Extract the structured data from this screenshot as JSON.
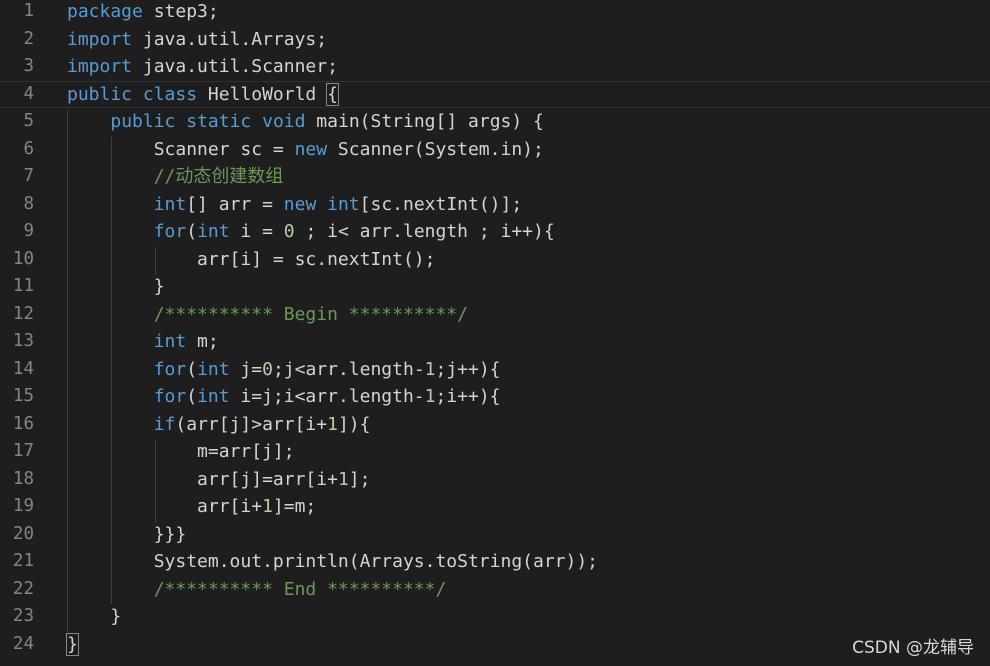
{
  "colors": {
    "background": "#1e1e1e",
    "line_number": "#858585",
    "default_text": "#d4d4d4",
    "keyword": "#569cd6",
    "number": "#b5cea8",
    "comment": "#6a9955"
  },
  "editor": {
    "current_line": 4,
    "lines": [
      {
        "number": "1",
        "tokens": [
          {
            "t": "package",
            "k": "keyword"
          },
          {
            "t": " step3;",
            "k": "text"
          }
        ]
      },
      {
        "number": "2",
        "tokens": [
          {
            "t": "import",
            "k": "keyword"
          },
          {
            "t": " java.util.Arrays;",
            "k": "text"
          }
        ]
      },
      {
        "number": "3",
        "tokens": [
          {
            "t": "import",
            "k": "keyword"
          },
          {
            "t": " java.util.Scanner;",
            "k": "text"
          }
        ]
      },
      {
        "number": "4",
        "tokens": [
          {
            "t": "public",
            "k": "keyword"
          },
          {
            "t": " ",
            "k": "text"
          },
          {
            "t": "class",
            "k": "keyword"
          },
          {
            "t": " HelloWorld ",
            "k": "text"
          },
          {
            "t": "{",
            "k": "brace-highlight"
          }
        ]
      },
      {
        "number": "5",
        "tokens": [
          {
            "t": "    ",
            "k": "text"
          },
          {
            "t": "public",
            "k": "keyword"
          },
          {
            "t": " ",
            "k": "text"
          },
          {
            "t": "static",
            "k": "keyword"
          },
          {
            "t": " ",
            "k": "text"
          },
          {
            "t": "void",
            "k": "keyword"
          },
          {
            "t": " main(String[] args) {",
            "k": "text"
          }
        ]
      },
      {
        "number": "6",
        "tokens": [
          {
            "t": "        Scanner sc = ",
            "k": "text"
          },
          {
            "t": "new",
            "k": "keyword"
          },
          {
            "t": " Scanner(System.in);",
            "k": "text"
          }
        ]
      },
      {
        "number": "7",
        "tokens": [
          {
            "t": "        ",
            "k": "text"
          },
          {
            "t": "//动态创建数组",
            "k": "comment"
          }
        ]
      },
      {
        "number": "8",
        "tokens": [
          {
            "t": "        ",
            "k": "text"
          },
          {
            "t": "int",
            "k": "keyword"
          },
          {
            "t": "[] arr = ",
            "k": "text"
          },
          {
            "t": "new",
            "k": "keyword"
          },
          {
            "t": " ",
            "k": "text"
          },
          {
            "t": "int",
            "k": "keyword"
          },
          {
            "t": "[sc.nextInt()];",
            "k": "text"
          }
        ]
      },
      {
        "number": "9",
        "tokens": [
          {
            "t": "        ",
            "k": "text"
          },
          {
            "t": "for",
            "k": "control"
          },
          {
            "t": "(",
            "k": "text"
          },
          {
            "t": "int",
            "k": "keyword"
          },
          {
            "t": " i = ",
            "k": "text"
          },
          {
            "t": "0",
            "k": "number"
          },
          {
            "t": " ; i< arr.length ; i++){",
            "k": "text"
          }
        ]
      },
      {
        "number": "10",
        "tokens": [
          {
            "t": "            arr[i] = sc.nextInt();",
            "k": "text"
          }
        ]
      },
      {
        "number": "11",
        "tokens": [
          {
            "t": "        }",
            "k": "text"
          }
        ]
      },
      {
        "number": "12",
        "tokens": [
          {
            "t": "        ",
            "k": "text"
          },
          {
            "t": "/********** Begin **********/",
            "k": "comment"
          }
        ]
      },
      {
        "number": "13",
        "tokens": [
          {
            "t": "        ",
            "k": "text"
          },
          {
            "t": "int",
            "k": "keyword"
          },
          {
            "t": " m;",
            "k": "text"
          }
        ]
      },
      {
        "number": "14",
        "tokens": [
          {
            "t": "        ",
            "k": "text"
          },
          {
            "t": "for",
            "k": "control"
          },
          {
            "t": "(",
            "k": "text"
          },
          {
            "t": "int",
            "k": "keyword"
          },
          {
            "t": " j=",
            "k": "text"
          },
          {
            "t": "0",
            "k": "number"
          },
          {
            "t": ";j<arr.length-",
            "k": "text"
          },
          {
            "t": "1",
            "k": "number"
          },
          {
            "t": ";j++){",
            "k": "text"
          }
        ]
      },
      {
        "number": "15",
        "tokens": [
          {
            "t": "        ",
            "k": "text"
          },
          {
            "t": "for",
            "k": "control"
          },
          {
            "t": "(",
            "k": "text"
          },
          {
            "t": "int",
            "k": "keyword"
          },
          {
            "t": " i=j;i<arr.length-",
            "k": "text"
          },
          {
            "t": "1",
            "k": "number"
          },
          {
            "t": ";i++){",
            "k": "text"
          }
        ]
      },
      {
        "number": "16",
        "tokens": [
          {
            "t": "        ",
            "k": "text"
          },
          {
            "t": "if",
            "k": "control"
          },
          {
            "t": "(arr[j]>arr[i+",
            "k": "text"
          },
          {
            "t": "1",
            "k": "number"
          },
          {
            "t": "]){",
            "k": "text"
          }
        ]
      },
      {
        "number": "17",
        "tokens": [
          {
            "t": "            m=arr[j];",
            "k": "text"
          }
        ]
      },
      {
        "number": "18",
        "tokens": [
          {
            "t": "            arr[j]=arr[i+",
            "k": "text"
          },
          {
            "t": "1",
            "k": "number"
          },
          {
            "t": "];",
            "k": "text"
          }
        ]
      },
      {
        "number": "19",
        "tokens": [
          {
            "t": "            arr[i+",
            "k": "text"
          },
          {
            "t": "1",
            "k": "number"
          },
          {
            "t": "]=m;",
            "k": "text"
          }
        ]
      },
      {
        "number": "20",
        "tokens": [
          {
            "t": "        }}}",
            "k": "text"
          }
        ]
      },
      {
        "number": "21",
        "tokens": [
          {
            "t": "        System.out.println(Arrays.toString(arr));",
            "k": "text"
          }
        ]
      },
      {
        "number": "22",
        "tokens": [
          {
            "t": "        ",
            "k": "text"
          },
          {
            "t": "/********** End **********/",
            "k": "comment"
          }
        ]
      },
      {
        "number": "23",
        "tokens": [
          {
            "t": "    }",
            "k": "text"
          }
        ]
      },
      {
        "number": "24",
        "tokens": [
          {
            "t": "}",
            "k": "brace-highlight"
          }
        ]
      }
    ]
  },
  "watermark": {
    "text": "CSDN @龙辅导"
  }
}
